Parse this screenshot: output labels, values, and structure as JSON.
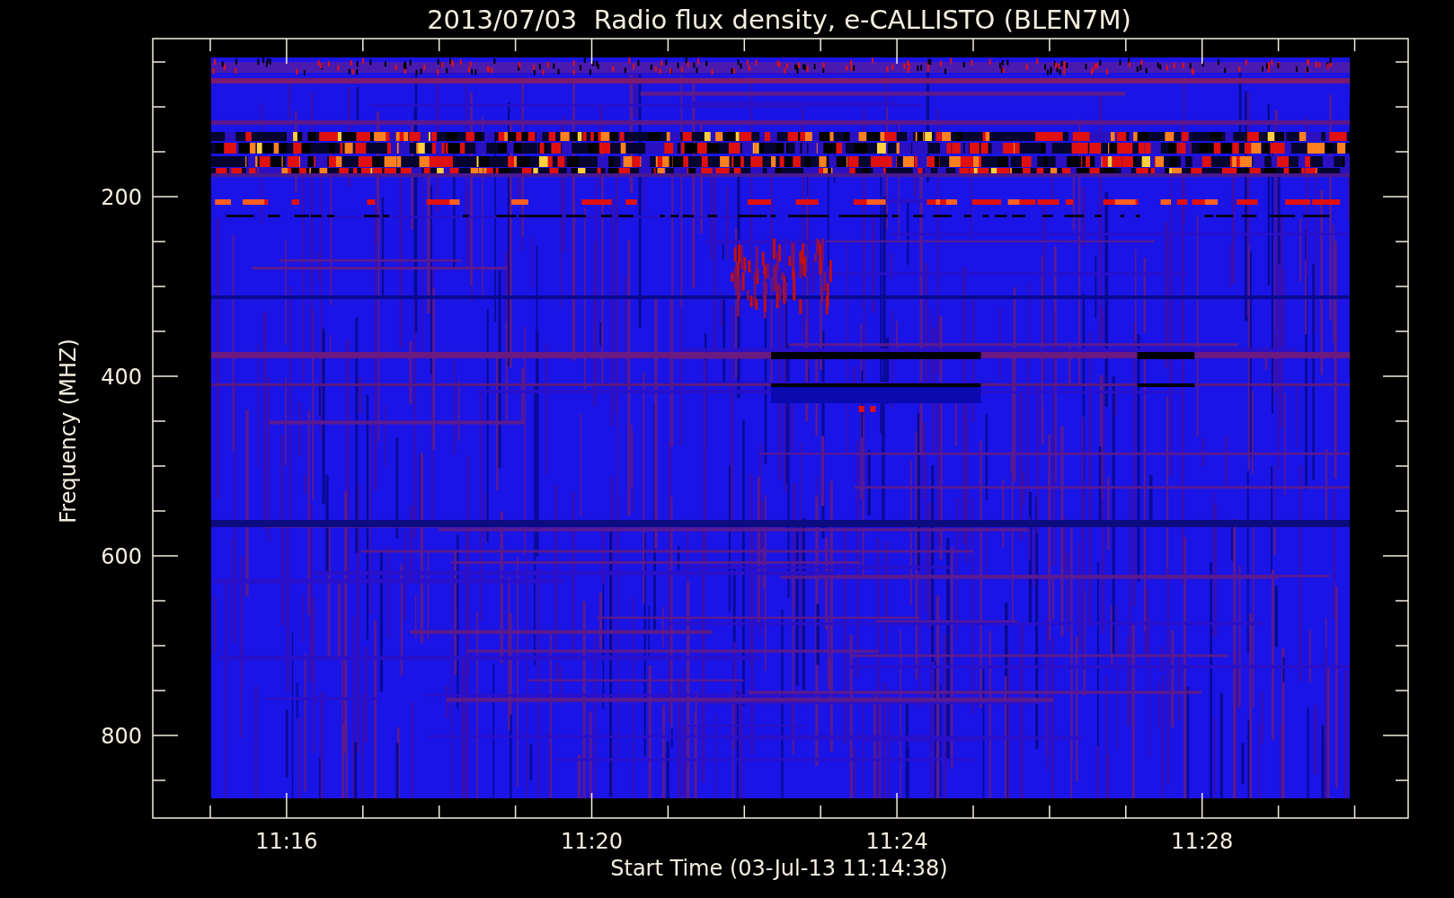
{
  "plot": {
    "title": "2013/07/03  Radio flux density, e-CALLISTO (BLEN7M)",
    "ylabel": "Frequency (MHZ)",
    "xlabel": "Start Time (03-Jul-13 11:14:38)",
    "yticks": [
      "200",
      "400",
      "600",
      "800"
    ],
    "xticks": [
      "11:16",
      "11:20",
      "11:24",
      "11:28"
    ]
  }
}
